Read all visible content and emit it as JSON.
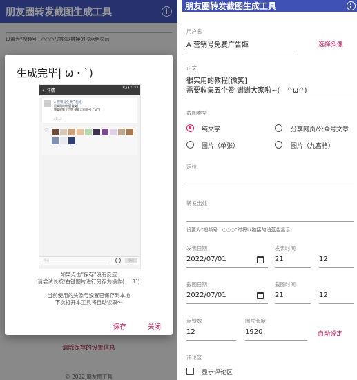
{
  "app": {
    "title": "朋友圈转发截图生成工具"
  },
  "left": {
    "hint": "设置为\"视频号 · ○○○\"时将以链接的浅蓝色显示",
    "clear_link": "清除保存的设置信息",
    "copyright": "© 2022 朋友圈工具",
    "dialog": {
      "title": "生成完毕| ω・`)",
      "hint_line1": "如果点击\"保存\"没有反应",
      "hint_line2": "请尝试长按/右键图片进行另存为操作(　´3`)",
      "hint_line3": "当前使用的头像与设置已保存到本地",
      "hint_line4": "下次打开本工具将自动读取～",
      "save": "保存",
      "close": "关闭",
      "preview": {
        "status": "▼◢ ▮ 21:13",
        "nav_title": "详情",
        "name": "A 营销号免费广告姬",
        "text": "很实用的教程[微笑]\n需要收集五个赞 谢谢大家啦~( ^ω^)",
        "time": "21:13",
        "comment_placeholder": "评论",
        "send": "发送"
      }
    }
  },
  "right": {
    "username": {
      "label": "用户名",
      "value": "A 营销号免费广告姬",
      "action": "选择头像"
    },
    "body": {
      "label": "正文",
      "line1": "很实用的教程[微笑]",
      "line2": "需要收集五个赞 谢谢大家啦~(　^ω^)"
    },
    "screenshot_type": {
      "label": "截图类型",
      "options": [
        "纯文字",
        "分享网页/公众号文章",
        "图片（单张）",
        "图片（九宫格）"
      ],
      "selected": 0
    },
    "location": {
      "label": "定位"
    },
    "forward_source": {
      "label": "转发出处"
    },
    "hint": "设置为\"视频号 · ○○○\"时将以链接的浅蓝色显示",
    "post_date": {
      "label": "发表日期",
      "value": "2022/07/01"
    },
    "post_time": {
      "label": "发表时间",
      "hour": "21",
      "minute": "12"
    },
    "shot_date": {
      "label": "截图日期",
      "value": "2022/07/01"
    },
    "shot_time": {
      "label": "截图时间",
      "hour": "21",
      "minute": "12"
    },
    "likes": {
      "label": "点赞数",
      "value": "12"
    },
    "image_length": {
      "label": "图片长度",
      "value": "1920",
      "action": "自动设定"
    },
    "comments": {
      "label": "评论区",
      "checkbox_label": "显示评论区"
    }
  },
  "colors": {
    "primary": "#3f51b5",
    "accent": "#e91e63",
    "link": "#c2185b"
  }
}
